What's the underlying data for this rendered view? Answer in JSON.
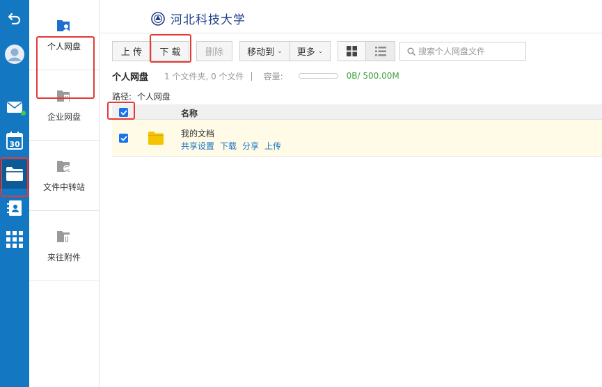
{
  "header": {
    "logo_text": "河北科技大学"
  },
  "rail": {
    "items": [
      {
        "icon": "back-arrow-icon"
      },
      {
        "icon": "avatar-icon"
      },
      {
        "icon": "mail-icon",
        "status": "online"
      },
      {
        "icon": "calendar-icon",
        "text": "30"
      },
      {
        "icon": "folder-icon",
        "active": true
      },
      {
        "icon": "contacts-icon"
      },
      {
        "icon": "apps-grid-icon"
      }
    ]
  },
  "subnav": {
    "items": [
      {
        "label": "个人网盘",
        "icon": "personal-disk-icon",
        "active": true
      },
      {
        "label": "企业网盘",
        "icon": "enterprise-disk-icon"
      },
      {
        "label": "文件中转站",
        "icon": "transfer-station-icon"
      },
      {
        "label": "来往附件",
        "icon": "attachment-icon"
      }
    ]
  },
  "toolbar": {
    "upload": "上 传",
    "download": "下 载",
    "delete": "删除",
    "move_to": "移动到",
    "more": "更多",
    "search_placeholder": "搜索个人网盘文件"
  },
  "info": {
    "title": "个人网盘",
    "summary": "1 个文件夹, 0 个文件",
    "separator": "|",
    "capacity_label": "容量:",
    "quota": "0B/ 500.00M",
    "usage": 0
  },
  "path": {
    "label": "路径:",
    "value": "个人网盘"
  },
  "table": {
    "header_name": "名称",
    "rows": [
      {
        "name": "我的文档",
        "actions": [
          "共享设置",
          "下载",
          "分享",
          "上传"
        ],
        "checked": true
      }
    ]
  },
  "colors": {
    "rail": "#1477c2",
    "highlight": "#e53935",
    "link": "#1a73c6",
    "quota": "#3aa03a"
  }
}
